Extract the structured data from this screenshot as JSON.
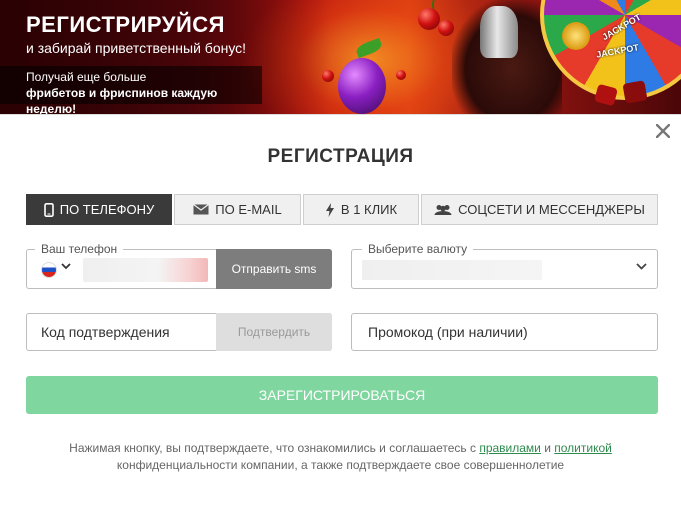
{
  "banner": {
    "title": "РЕГИСТРИРУЙСЯ",
    "subtitle": "и забирай приветственный бонус!",
    "promo_line1": "Получай еще больше",
    "promo_line2": "фрибетов и фриспинов каждую неделю!",
    "wheel_labels": [
      "JACKPOT",
      "JACKPOT"
    ]
  },
  "modal": {
    "title": "РЕГИСТРАЦИЯ",
    "close_icon": "close-icon",
    "tabs": [
      {
        "label": "ПО ТЕЛЕФОНУ",
        "icon": "phone-icon",
        "active": true
      },
      {
        "label": "ПО E-MAIL",
        "icon": "envelope-icon",
        "active": false
      },
      {
        "label": "В 1 КЛИК",
        "icon": "lightning-icon",
        "active": false
      },
      {
        "label": "СОЦСЕТИ И МЕССЕНДЖЕРЫ",
        "icon": "users-icon",
        "active": false
      }
    ],
    "phone": {
      "legend": "Ваш телефон",
      "send_sms_label": "Отправить sms",
      "country_icon": "russia-flag-icon"
    },
    "currency": {
      "legend": "Выберите валюту"
    },
    "code": {
      "placeholder": "Код подтверждения",
      "confirm_label": "Подтвердить"
    },
    "promo_code": {
      "placeholder": "Промокод (при наличии)"
    },
    "register_label": "ЗАРЕГИСТРИРОВАТЬСЯ",
    "terms": {
      "text_before": "Нажимая кнопку, вы подтверждаете, что ознакомились и соглашаетесь с ",
      "rules_link": "правилами",
      "and": " и ",
      "policy_link": "политикой",
      "text_after": "конфиденциальности компании, а также подтверждаете свое совершеннолетие"
    },
    "colors": {
      "active_tab": "#3a3a3a",
      "register_button": "#7fd69e",
      "send_sms_button": "#7d7d7d",
      "link": "#2e8b4e"
    }
  }
}
